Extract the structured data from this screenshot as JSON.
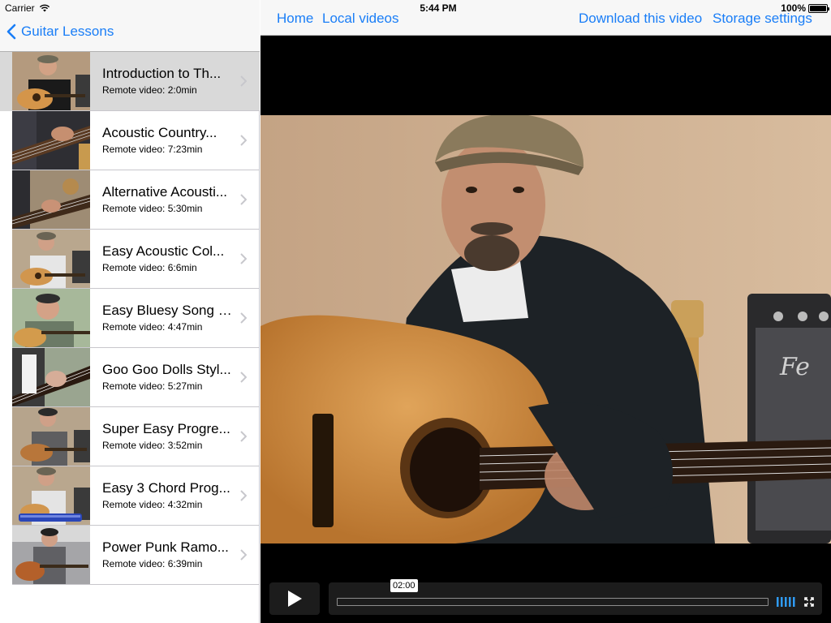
{
  "status_bar": {
    "carrier": "Carrier",
    "time": "5:44 PM",
    "battery": "100%"
  },
  "left_nav": {
    "back_label": "Guitar Lessons"
  },
  "videos": [
    {
      "title": "Introduction to Th...",
      "subtitle": "Remote video: 2:0min",
      "selected": true
    },
    {
      "title": "Acoustic Country...",
      "subtitle": "Remote video: 7:23min"
    },
    {
      "title": "Alternative Acousti...",
      "subtitle": "Remote video: 5:30min"
    },
    {
      "title": "Easy Acoustic Col...",
      "subtitle": "Remote video: 6:6min"
    },
    {
      "title": "Easy Bluesy Song i...",
      "subtitle": "Remote video: 4:47min"
    },
    {
      "title": "Goo Goo Dolls Styl...",
      "subtitle": "Remote video: 5:27min"
    },
    {
      "title": "Super Easy Progre...",
      "subtitle": "Remote video: 3:52min"
    },
    {
      "title": "Easy 3 Chord Prog...",
      "subtitle": "Remote video: 4:32min"
    },
    {
      "title": "Power Punk Ramo...",
      "subtitle": "Remote video: 6:39min"
    }
  ],
  "right_nav": {
    "home": "Home",
    "local_videos": "Local videos",
    "download": "Download this video",
    "storage": "Storage settings"
  },
  "player": {
    "time_bubble": "02:00",
    "progress": 0
  },
  "colors": {
    "accent": "#1a7ef7",
    "selected_row": "#d9d9d9",
    "nav_bg": "#f7f7f7"
  }
}
